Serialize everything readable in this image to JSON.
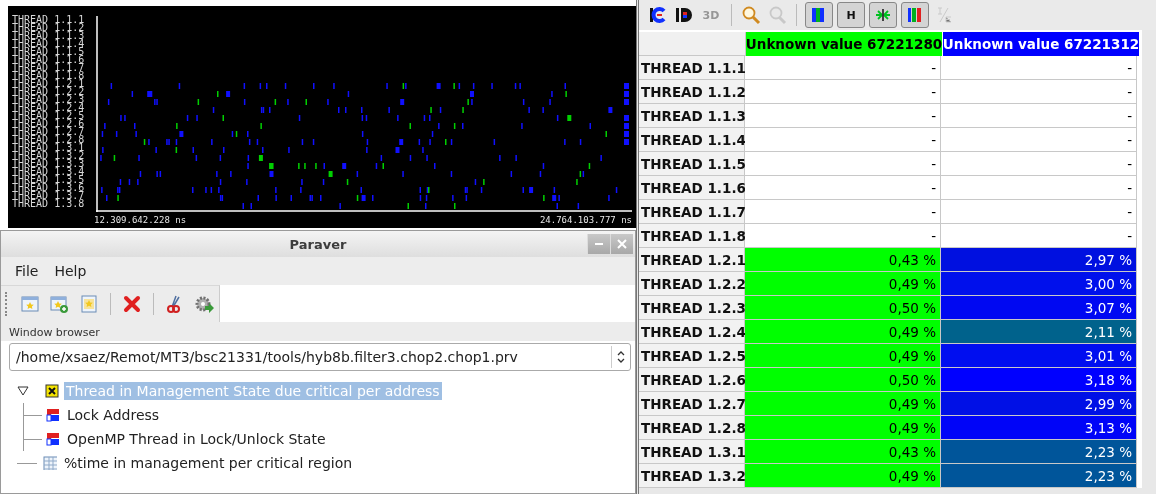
{
  "timeline": {
    "rows": [
      "THREAD 1.1.1",
      "THREAD 1.1.2",
      "THREAD 1.1.3",
      "THREAD 1.1.4",
      "THREAD 1.1.5",
      "THREAD 1.1.6",
      "THREAD 1.1.7",
      "THREAD 1.1.8",
      "THREAD 1.2.1",
      "THREAD 1.2.2",
      "THREAD 1.2.3",
      "THREAD 1.2.4",
      "THREAD 1.2.5",
      "THREAD 1.2.6",
      "THREAD 1.2.7",
      "THREAD 1.2.8",
      "THREAD 1.3.1",
      "THREAD 1.3.2",
      "THREAD 1.3.3",
      "THREAD 1.3.4",
      "THREAD 1.3.5",
      "THREAD 1.3.6",
      "THREAD 1.3.7",
      "THREAD 1.3.8"
    ],
    "start_time": "12.309.642.228 ns",
    "end_time": "24.764.103.777 ns"
  },
  "paraver_window": {
    "title": "Paraver",
    "menu": [
      "File",
      "Help"
    ],
    "browser_label": "Window browser",
    "trace_path": "/home/xsaez/Remot/MT3/bsc21331/tools/hyb8b.filter3.chop2.chop1.prv",
    "tree": [
      {
        "label": "Thread in Management State due critical per address",
        "kind": "group",
        "selected": true,
        "expanded": true,
        "children": [
          {
            "label": "Lock Address",
            "kind": "timeline",
            "selected": false
          },
          {
            "label": "OpenMP Thread in Lock/Unlock State",
            "kind": "timeline",
            "selected": false
          }
        ]
      },
      {
        "label": "%time in management per critical region",
        "kind": "histogram",
        "selected": false
      }
    ]
  },
  "histogram": {
    "toolbar": [
      {
        "kind": "icon",
        "disabled": false
      },
      {
        "kind": "icon",
        "disabled": false
      },
      {
        "kind": "label",
        "text": "3D",
        "disabled": true
      },
      {
        "kind": "separator"
      },
      {
        "kind": "icon",
        "disabled": false
      },
      {
        "kind": "icon",
        "disabled": true
      },
      {
        "kind": "separator"
      },
      {
        "kind": "toggle"
      },
      {
        "kind": "toggle",
        "text": "H"
      },
      {
        "kind": "toggle"
      },
      {
        "kind": "toggle"
      },
      {
        "kind": "icon",
        "disabled": true
      }
    ],
    "columns": [
      {
        "label": "Unknown value 67221280",
        "color": "#00ff00"
      },
      {
        "label": "Unknown value 67221312",
        "color": "#0000ff"
      }
    ],
    "rows": [
      {
        "label": "THREAD 1.1.1",
        "cells": [
          {
            "text": "-",
            "color": "#ffffff"
          },
          {
            "text": "-",
            "color": "#ffffff"
          }
        ]
      },
      {
        "label": "THREAD 1.1.2",
        "cells": [
          {
            "text": "-",
            "color": "#ffffff"
          },
          {
            "text": "-",
            "color": "#ffffff"
          }
        ]
      },
      {
        "label": "THREAD 1.1.3",
        "cells": [
          {
            "text": "-",
            "color": "#ffffff"
          },
          {
            "text": "-",
            "color": "#ffffff"
          }
        ]
      },
      {
        "label": "THREAD 1.1.4",
        "cells": [
          {
            "text": "-",
            "color": "#ffffff"
          },
          {
            "text": "-",
            "color": "#ffffff"
          }
        ]
      },
      {
        "label": "THREAD 1.1.5",
        "cells": [
          {
            "text": "-",
            "color": "#ffffff"
          },
          {
            "text": "-",
            "color": "#ffffff"
          }
        ]
      },
      {
        "label": "THREAD 1.1.6",
        "cells": [
          {
            "text": "-",
            "color": "#ffffff"
          },
          {
            "text": "-",
            "color": "#ffffff"
          }
        ]
      },
      {
        "label": "THREAD 1.1.7",
        "cells": [
          {
            "text": "-",
            "color": "#ffffff"
          },
          {
            "text": "-",
            "color": "#ffffff"
          }
        ]
      },
      {
        "label": "THREAD 1.1.8",
        "cells": [
          {
            "text": "-",
            "color": "#ffffff"
          },
          {
            "text": "-",
            "color": "#ffffff"
          }
        ]
      },
      {
        "label": "THREAD 1.2.1",
        "cells": [
          {
            "text": "0,43 %",
            "color": "#00ff00"
          },
          {
            "text": "2,97 %",
            "color": "#0010e0"
          }
        ]
      },
      {
        "label": "THREAD 1.2.2",
        "cells": [
          {
            "text": "0,49 %",
            "color": "#00ff00"
          },
          {
            "text": "3,00 %",
            "color": "#0010ec"
          }
        ]
      },
      {
        "label": "THREAD 1.2.3",
        "cells": [
          {
            "text": "0,50 %",
            "color": "#00ff00"
          },
          {
            "text": "3,07 %",
            "color": "#0008f2"
          }
        ]
      },
      {
        "label": "THREAD 1.2.4",
        "cells": [
          {
            "text": "0,49 %",
            "color": "#00ff00"
          },
          {
            "text": "2,11 %",
            "color": "#00628c"
          }
        ]
      },
      {
        "label": "THREAD 1.2.5",
        "cells": [
          {
            "text": "0,49 %",
            "color": "#00ff00"
          },
          {
            "text": "3,01 %",
            "color": "#000ef0"
          }
        ]
      },
      {
        "label": "THREAD 1.2.6",
        "cells": [
          {
            "text": "0,50 %",
            "color": "#00ff00"
          },
          {
            "text": "3,18 %",
            "color": "#0000ff"
          }
        ]
      },
      {
        "label": "THREAD 1.2.7",
        "cells": [
          {
            "text": "0,49 %",
            "color": "#00ff00"
          },
          {
            "text": "2,99 %",
            "color": "#0010e6"
          }
        ]
      },
      {
        "label": "THREAD 1.2.8",
        "cells": [
          {
            "text": "0,49 %",
            "color": "#00ff00"
          },
          {
            "text": "3,13 %",
            "color": "#0004f8"
          }
        ]
      },
      {
        "label": "THREAD 1.3.1",
        "cells": [
          {
            "text": "0,43 %",
            "color": "#00ff00"
          },
          {
            "text": "2,23 %",
            "color": "#00559a"
          }
        ]
      },
      {
        "label": "THREAD 1.3.2",
        "cells": [
          {
            "text": "0,49 %",
            "color": "#00ff00"
          },
          {
            "text": "2,23 %",
            "color": "#00559a"
          }
        ]
      }
    ]
  }
}
